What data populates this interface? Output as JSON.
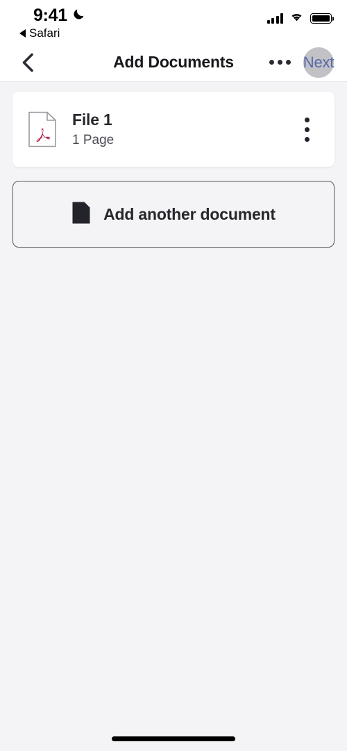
{
  "status_bar": {
    "time": "9:41",
    "dnd_icon": "moon-icon",
    "back_to_app_label": "Safari",
    "back_triangle_icon": "triangle-left-icon",
    "cellular_icon": "signal-bars-icon",
    "wifi_icon": "wifi-icon",
    "battery_icon": "battery-full-icon"
  },
  "nav_bar": {
    "back_icon": "chevron-left-icon",
    "title": "Add Documents",
    "more_icon": "ellipsis-horizontal-icon",
    "next_label": "Next",
    "next_color": "#3c5bc8",
    "tap_indicator": "touch-indicator"
  },
  "documents": [
    {
      "file_icon": "pdf-file-icon",
      "name": "File 1",
      "pages": "1 Page",
      "menu_icon": "kebab-menu-icon"
    }
  ],
  "add_button": {
    "icon": "document-add-icon",
    "label": "Add another document"
  },
  "home_indicator": "home-indicator-bar",
  "colors": {
    "page_background": "#f4f4f6",
    "card_background": "#ffffff",
    "primary_text": "#26262c",
    "secondary_text": "#4b4b55",
    "accent_blue": "#3c5bc8",
    "pdf_red": "#b1244a",
    "border": "#555560"
  }
}
